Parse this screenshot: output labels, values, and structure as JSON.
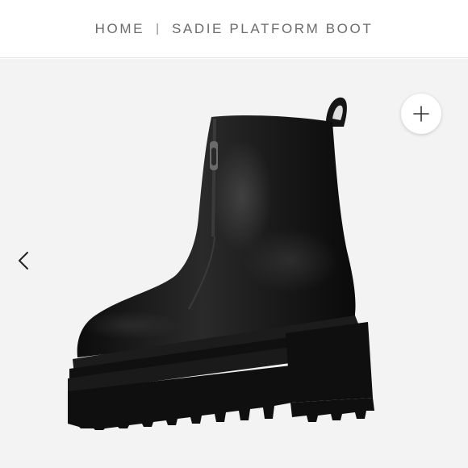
{
  "breadcrumb": {
    "home_label": "HOME",
    "separator": "|",
    "current_label": "SADIE PLATFORM BOOT"
  },
  "gallery": {
    "image_alt": "Sadie Platform Boot",
    "prev_icon": "chevron-left-icon",
    "zoom_icon": "plus-icon"
  },
  "colors": {
    "breadcrumb_text": "#6b6b6b",
    "gallery_background": "#f3f3f3",
    "boot": "#131313",
    "sole": "#0f0f0f"
  }
}
